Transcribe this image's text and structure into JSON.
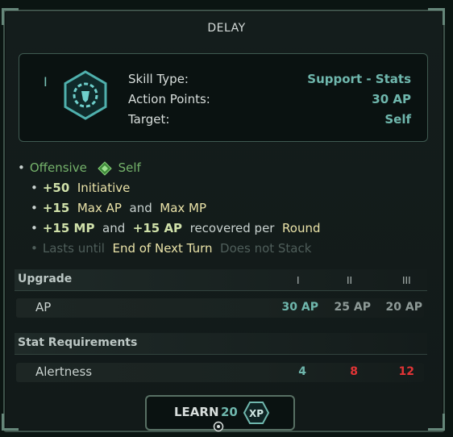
{
  "title": "DELAY",
  "skill": {
    "rank": "I",
    "icon": "shield-chain-icon",
    "rows": [
      {
        "label": "Skill Type:",
        "value": "Support - Stats"
      },
      {
        "label": "Action Points:",
        "value": "30 AP"
      },
      {
        "label": "Target:",
        "value": "Self"
      }
    ]
  },
  "effects": {
    "header": {
      "type": "Offensive",
      "target": "Self",
      "icon": "green-diamond-icon"
    },
    "initiative": {
      "amount": "+50",
      "label": "Initiative"
    },
    "max": {
      "amount": "+15",
      "a": "Max AP",
      "and": "and",
      "b": "Max MP"
    },
    "recover": {
      "mp": "+15 MP",
      "and": "and",
      "ap": "+15 AP",
      "text": "recovered per",
      "unit": "Round"
    },
    "duration": {
      "prefix": "Lasts until",
      "value": "End of Next Turn",
      "suffix": "Does not Stack"
    }
  },
  "upgrade": {
    "title": "Upgrade",
    "ranks": [
      "I",
      "II",
      "III"
    ],
    "row": {
      "label": "AP",
      "values": [
        "30 AP",
        "25 AP",
        "20 AP"
      ]
    }
  },
  "requirements": {
    "title": "Stat Requirements",
    "row": {
      "label": "Alertness",
      "values": [
        "4",
        "8",
        "12"
      ]
    }
  },
  "learn": {
    "label": "LEARN",
    "cost": "20",
    "currency": "XP"
  },
  "colors": {
    "accent": "#6fb7ad",
    "unmet": "#e23436",
    "met": "#6fb7ad"
  }
}
